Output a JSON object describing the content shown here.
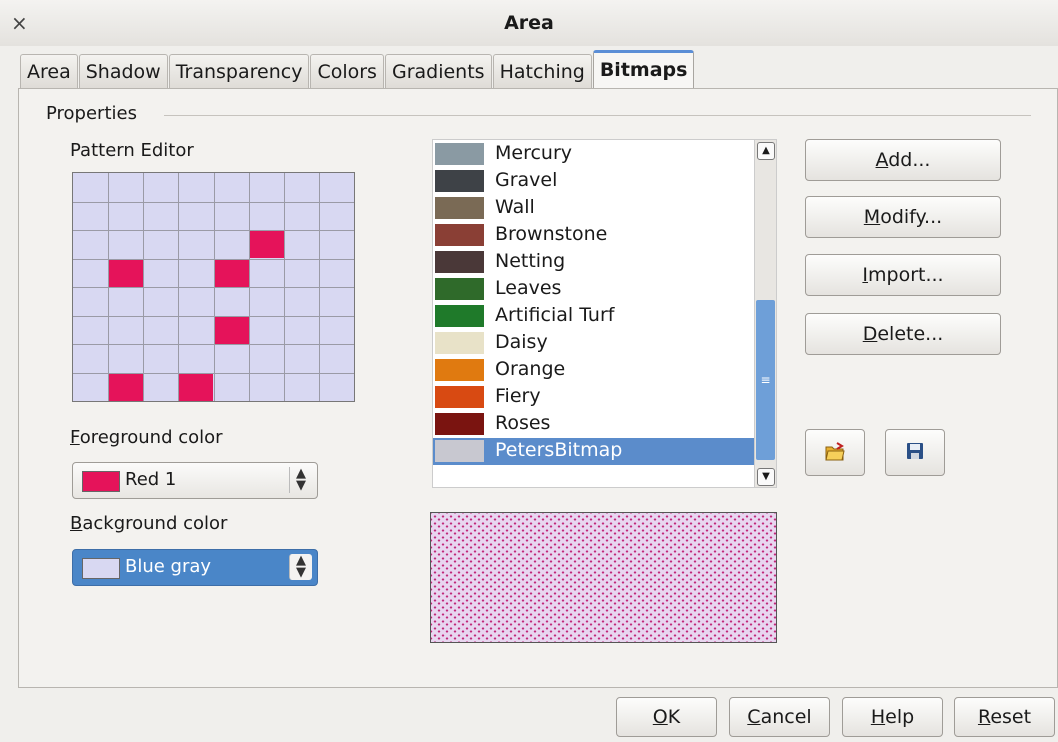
{
  "window": {
    "title": "Area",
    "close_glyph": "×"
  },
  "tabs": [
    "Area",
    "Shadow",
    "Transparency",
    "Colors",
    "Gradients",
    "Hatching",
    "Bitmaps"
  ],
  "active_tab": "Bitmaps",
  "properties": {
    "section_label": "Properties",
    "pattern_editor_label": "Pattern Editor",
    "pattern_grid": {
      "columns": 8,
      "rows": 8,
      "filled_cells": [
        [
          2,
          5
        ],
        [
          3,
          1
        ],
        [
          3,
          4
        ],
        [
          5,
          4
        ],
        [
          7,
          1
        ],
        [
          7,
          3
        ]
      ]
    },
    "foreground": {
      "label_key": "F",
      "label_rest": "oreground color",
      "value": "Red 1",
      "swatch_color": "#e5135a"
    },
    "background": {
      "label_key": "B",
      "label_rest": "ackground color",
      "value": "Blue gray",
      "swatch_color": "#d8d8f2"
    }
  },
  "bitmap_list": {
    "items": [
      {
        "name": "Mercury",
        "thumb": "#8a9aa3"
      },
      {
        "name": "Gravel",
        "thumb": "#3e4247"
      },
      {
        "name": "Wall",
        "thumb": "#7a6a55"
      },
      {
        "name": "Brownstone",
        "thumb": "#8a3f35"
      },
      {
        "name": "Netting",
        "thumb": "#4a3838"
      },
      {
        "name": "Leaves",
        "thumb": "#2f6a2a"
      },
      {
        "name": "Artificial Turf",
        "thumb": "#1f7a2a"
      },
      {
        "name": "Daisy",
        "thumb": "#e8e2c8"
      },
      {
        "name": "Orange",
        "thumb": "#e07a10"
      },
      {
        "name": "Fiery",
        "thumb": "#d84a12"
      },
      {
        "name": "Roses",
        "thumb": "#7a1410"
      },
      {
        "name": "PetersBitmap",
        "thumb": "#c8c8d0"
      }
    ],
    "selected": "PetersBitmap"
  },
  "side_buttons": [
    {
      "key": "A",
      "rest": "dd..."
    },
    {
      "key": "M",
      "rest": "odify..."
    },
    {
      "key": "I",
      "rest": "mport..."
    },
    {
      "key": "D",
      "rest": "elete..."
    }
  ],
  "icons": {
    "open": "open-folder-icon",
    "save": "save-disk-icon"
  },
  "bottom_buttons": [
    {
      "key": "O",
      "rest": "K"
    },
    {
      "key": "C",
      "rest": "ancel"
    },
    {
      "key": "H",
      "rest": "elp"
    },
    {
      "key": "R",
      "rest": "eset"
    }
  ]
}
